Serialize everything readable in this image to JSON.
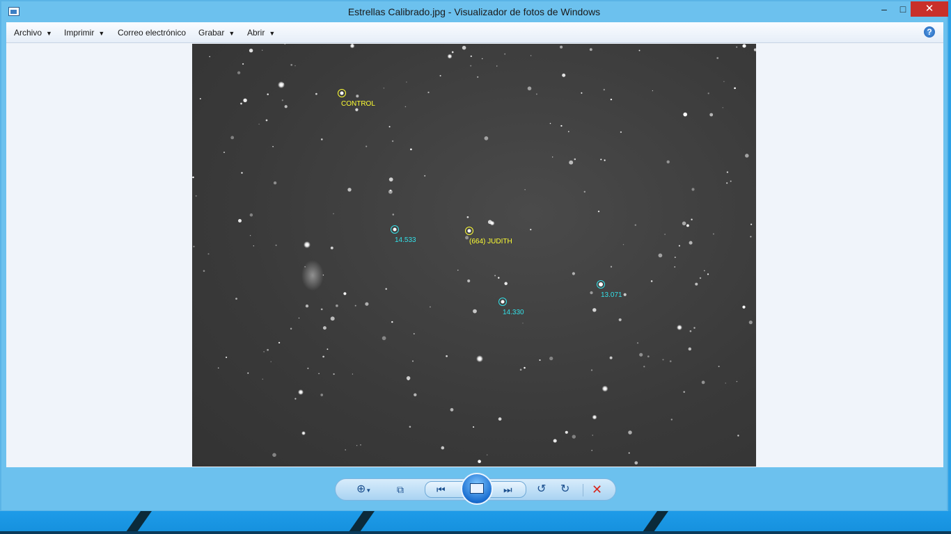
{
  "window": {
    "title": "Estrellas Calibrado.jpg - Visualizador de fotos de Windows",
    "controls": {
      "minimize": "‒",
      "maximize": "□",
      "close": "✕"
    }
  },
  "menubar": {
    "items": [
      {
        "label": "Archivo",
        "has_dropdown": true
      },
      {
        "label": "Imprimir",
        "has_dropdown": true
      },
      {
        "label": "Correo electrónico",
        "has_dropdown": false
      },
      {
        "label": "Grabar",
        "has_dropdown": true
      },
      {
        "label": "Abrir",
        "has_dropdown": true
      }
    ],
    "help": "?"
  },
  "photo": {
    "annotations": [
      {
        "text": "CONTROL",
        "color": "#ffff33"
      },
      {
        "text": "14.533",
        "color": "#33e0e8"
      },
      {
        "text": "(664) JUDITH",
        "color": "#ffff33"
      },
      {
        "text": "13.071",
        "color": "#33e0e8"
      },
      {
        "text": "14.330",
        "color": "#33e0e8"
      }
    ]
  },
  "toolbar": {
    "icons": [
      "zoom-icon",
      "actual-size-icon",
      "previous-icon",
      "slideshow-icon",
      "next-icon",
      "rotate-left-icon",
      "rotate-right-icon",
      "delete-icon"
    ]
  },
  "colors": {
    "accent": "#6cc1ee",
    "close": "#c9302a",
    "annot_yellow": "#ffff33",
    "annot_cyan": "#33e0e8"
  }
}
